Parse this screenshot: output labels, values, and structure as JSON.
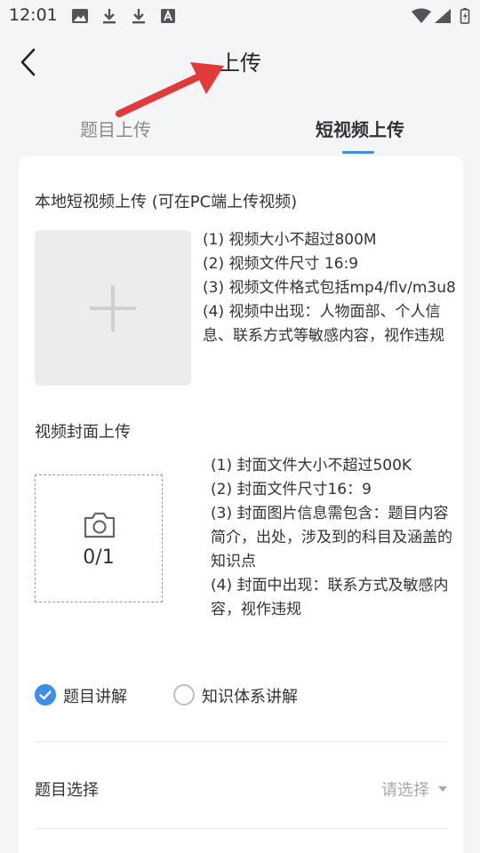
{
  "status_bar": {
    "time": "12:01",
    "left_icons": [
      "image-icon",
      "download-icon",
      "download-icon",
      "font-icon"
    ],
    "right_icons": [
      "wifi-icon",
      "signal-icon",
      "battery-charging-icon"
    ]
  },
  "header": {
    "title": "上传",
    "back_icon": "chevron-left-icon",
    "annotation_arrow_color": "#e03a3a"
  },
  "tabs": [
    {
      "label": "题目上传",
      "active": false
    },
    {
      "label": "短视频上传",
      "active": true
    }
  ],
  "colors": {
    "accent": "#3d8ee6",
    "background": "#f4f5f7",
    "card": "#ffffff",
    "placeholder_text": "#a8a8a8"
  },
  "local_video": {
    "title": "本地短视频上传 (可在PC端上传视频)",
    "upload_icon": "plus-icon",
    "requirements": [
      "(1) 视频大小不超过800M",
      "(2) 视频文件尺寸 16:9",
      "(3) 视频文件格式包括mp4/flv/m3u8",
      "(4) 视频中出现：人物面部、个人信息、联系方式等敏感内容，视作违规"
    ]
  },
  "cover": {
    "title": "视频封面上传",
    "camera_icon": "camera-icon",
    "count": "0/1",
    "requirements": [
      "(1) 封面文件大小不超过500K",
      "(2) 封面文件尺寸16：9",
      "(3) 封面图片信息需包含：题目内容简介，出处，涉及到的科目及涵盖的知识点",
      "(4) 封面中出现：联系方式及敏感内容，视作违规"
    ]
  },
  "explain_type": {
    "options": [
      {
        "label": "题目讲解",
        "selected": true
      },
      {
        "label": "知识体系讲解",
        "selected": false
      }
    ]
  },
  "topic_select": {
    "label": "题目选择",
    "placeholder": "请选择"
  }
}
